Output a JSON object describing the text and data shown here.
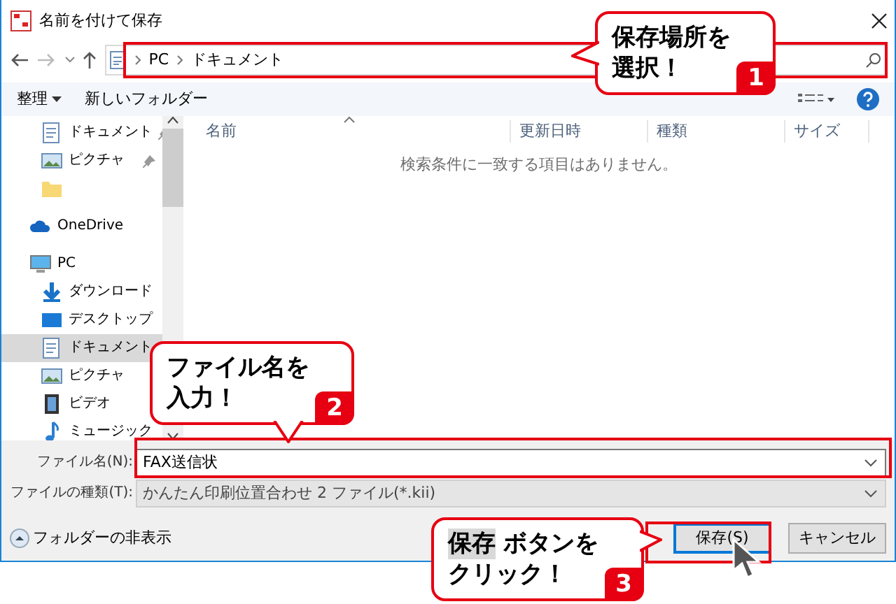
{
  "window": {
    "title": "名前を付けて保存"
  },
  "address": {
    "path": [
      "PC",
      "ドキュメント"
    ]
  },
  "toolbar": {
    "organize": "整理",
    "new_folder": "新しいフォルダー"
  },
  "sidebar": {
    "items": [
      {
        "label": "ドキュメント",
        "kind": "document",
        "pinned": true,
        "selected": false
      },
      {
        "label": "ピクチャ",
        "kind": "picture",
        "pinned": true,
        "selected": false
      },
      {
        "kind": "folder",
        "pinned": false,
        "selected": false
      },
      {
        "label": "OneDrive",
        "kind": "cloud",
        "pinned": false,
        "selected": false
      },
      {
        "label": "PC",
        "kind": "pc",
        "pinned": false,
        "selected": false,
        "children": [
          {
            "label": "ダウンロード",
            "kind": "download",
            "pinned": false,
            "selected": false
          },
          {
            "label": "デスクトップ",
            "kind": "desktop",
            "pinned": false,
            "selected": false
          },
          {
            "label": "ドキュメント",
            "kind": "document",
            "pinned": false,
            "selected": true
          },
          {
            "label": "ピクチャ",
            "kind": "picture",
            "pinned": false,
            "selected": false
          },
          {
            "label": "ビデオ",
            "kind": "video",
            "pinned": false,
            "selected": false
          },
          {
            "label": "ミュージック",
            "kind": "music",
            "pinned": false,
            "selected": false
          }
        ]
      }
    ]
  },
  "file_list": {
    "columns": [
      "名前",
      "更新日時",
      "種類",
      "サイズ"
    ],
    "empty_message": "検索条件に一致する項目はありません。"
  },
  "form": {
    "file_name": {
      "label": "ファイル名(N):",
      "value": "FAX送信状"
    },
    "file_type": {
      "label": "ファイルの種類(T):",
      "value": "かんたん印刷位置合わせ 2 ファイル(*.kii)"
    }
  },
  "hide_folders": "フォルダーの非表示",
  "buttons": [
    {
      "label": "保存(S)",
      "kind": "primary"
    },
    {
      "label": "キャンセル",
      "kind": "secondary"
    }
  ],
  "callouts": [
    {
      "lines": [
        "保存場所を",
        "選択！"
      ],
      "number": "1"
    },
    {
      "lines": [
        "ファイル名を",
        "入力！"
      ],
      "number": "2"
    },
    {
      "highlight": "保存",
      "lines": [
        "ボタンを",
        "クリック！"
      ],
      "number": "3"
    }
  ]
}
